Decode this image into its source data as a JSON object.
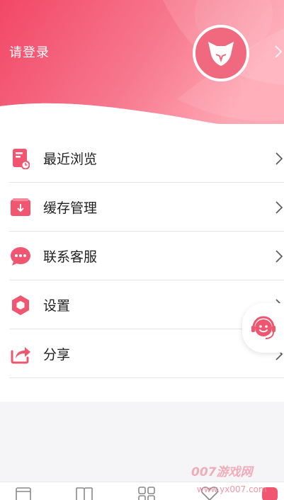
{
  "header": {
    "login_label": "请登录"
  },
  "menu": {
    "items": [
      {
        "label": "最近浏览",
        "icon": "history-document-icon"
      },
      {
        "label": "缓存管理",
        "icon": "download-box-icon"
      },
      {
        "label": "联系客服",
        "icon": "chat-bubble-icon"
      },
      {
        "label": "设置",
        "icon": "hexagon-settings-icon"
      },
      {
        "label": "分享",
        "icon": "share-arrow-icon"
      }
    ]
  },
  "bottom_tabs": [
    {
      "icon": "bookshelf-icon"
    },
    {
      "icon": "book-open-icon"
    },
    {
      "icon": "category-grid-icon"
    },
    {
      "icon": "heart-icon"
    },
    {
      "icon": "profile-icon"
    }
  ],
  "watermark": {
    "brand": "007游戏网",
    "url": "www.yx007.com"
  },
  "colors": {
    "accent": "#f0566f",
    "header_gradient_start": "#f34a67",
    "header_gradient_end": "#ff9cab"
  }
}
